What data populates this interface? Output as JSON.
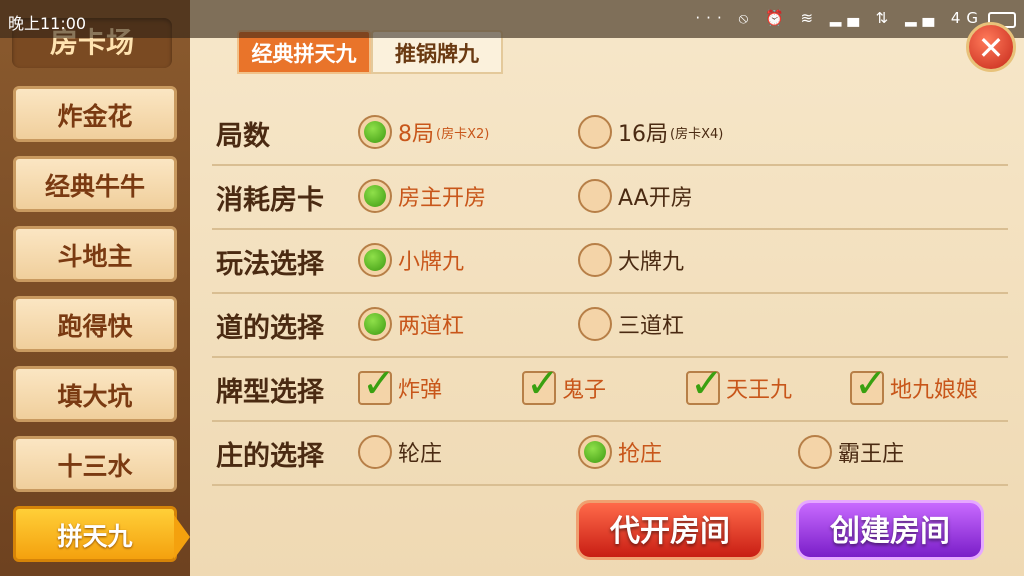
{
  "status": {
    "time": "晚上11:00",
    "icons": "··· ⦸ ⏰ ≋ ▂▄ ⇅ ▂▄ 4G"
  },
  "sidebar": {
    "title": "房卡场",
    "items": [
      {
        "label": "炸金花"
      },
      {
        "label": "经典牛牛"
      },
      {
        "label": "斗地主"
      },
      {
        "label": "跑得快"
      },
      {
        "label": "填大坑"
      },
      {
        "label": "十三水"
      },
      {
        "label": "拼天九"
      }
    ],
    "active_index": 6
  },
  "tabs": [
    {
      "label": "经典拼天九",
      "active": true
    },
    {
      "label": "推锅牌九",
      "active": false
    }
  ],
  "rows": [
    {
      "label": "局数",
      "type": "radio",
      "options": [
        {
          "label": "8局",
          "note": "(房卡X2)",
          "selected": true
        },
        {
          "label": "16局",
          "note": "(房卡X4)",
          "selected": false
        }
      ]
    },
    {
      "label": "消耗房卡",
      "type": "radio",
      "options": [
        {
          "label": "房主开房",
          "selected": true
        },
        {
          "label": "AA开房",
          "selected": false
        }
      ]
    },
    {
      "label": "玩法选择",
      "type": "radio",
      "options": [
        {
          "label": "小牌九",
          "selected": true
        },
        {
          "label": "大牌九",
          "selected": false
        }
      ]
    },
    {
      "label": "道的选择",
      "type": "radio",
      "options": [
        {
          "label": "两道杠",
          "selected": true
        },
        {
          "label": "三道杠",
          "selected": false
        }
      ]
    },
    {
      "label": "牌型选择",
      "type": "check",
      "options": [
        {
          "label": "炸弹",
          "selected": true
        },
        {
          "label": "鬼子",
          "selected": true
        },
        {
          "label": "天王九",
          "selected": true
        },
        {
          "label": "地九娘娘",
          "selected": true
        }
      ]
    },
    {
      "label": "庄的选择",
      "type": "radio",
      "options": [
        {
          "label": "轮庄",
          "selected": false
        },
        {
          "label": "抢庄",
          "selected": true
        },
        {
          "label": "霸王庄",
          "selected": false
        }
      ]
    }
  ],
  "buttons": {
    "proxy_open": "代开房间",
    "create": "创建房间",
    "close": "✕"
  },
  "colors": {
    "accent_orange": "#e9742a",
    "selected_green": "#3e9a12",
    "create_purple": "#7a1ec8",
    "proxy_red": "#c81e14"
  }
}
